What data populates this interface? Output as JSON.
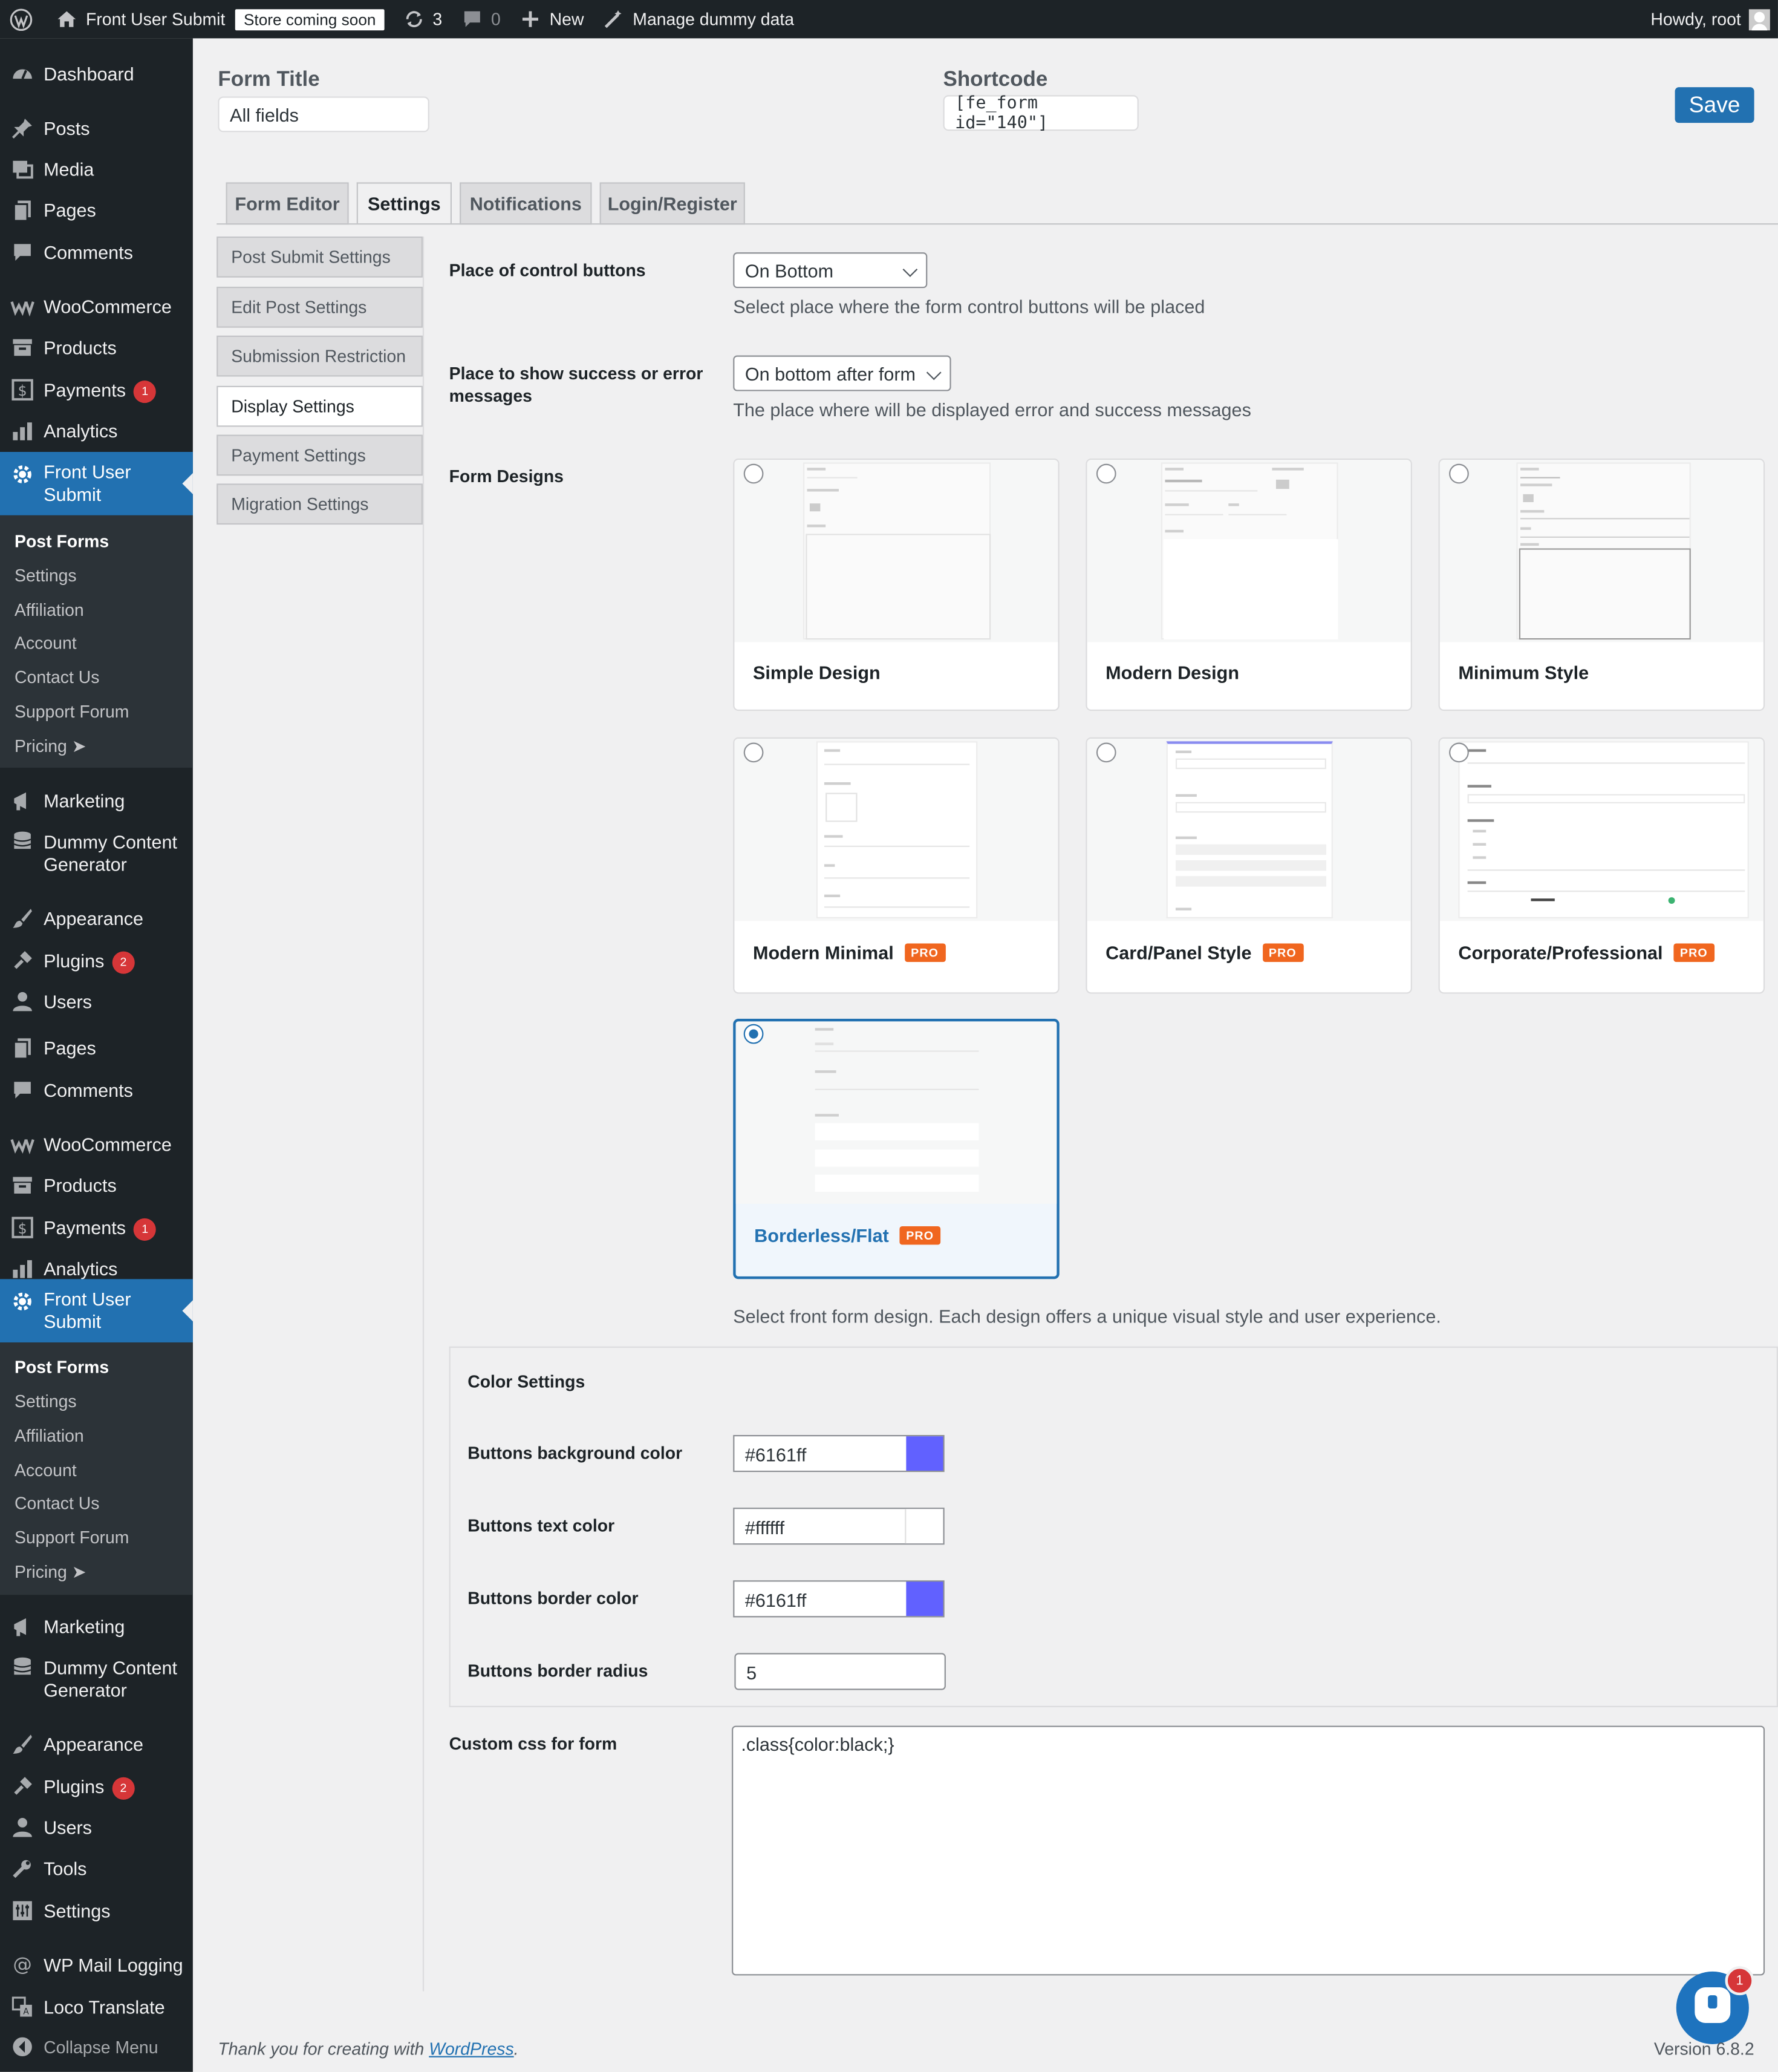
{
  "admin_bar": {
    "site_name": "Front User Submit",
    "coming_soon": "Store coming soon",
    "updates_count": "3",
    "comments_count": "0",
    "new_label": "New",
    "dummy_label": "Manage dummy data",
    "howdy": "Howdy, root"
  },
  "sidebar": {
    "items": [
      {
        "name": "Dashboard",
        "icon": "dashboard-icon"
      },
      {
        "name": "Posts",
        "icon": "pin-icon"
      },
      {
        "name": "Media",
        "icon": "media-icon"
      },
      {
        "name": "Pages",
        "icon": "page-icon"
      },
      {
        "name": "Comments",
        "icon": "comment-icon"
      },
      {
        "name": "WooCommerce",
        "icon": "woo-icon"
      },
      {
        "name": "Products",
        "icon": "archive-icon"
      },
      {
        "name": "Payments",
        "icon": "payments-icon",
        "badge": "1"
      },
      {
        "name": "Analytics",
        "icon": "chart-icon"
      },
      {
        "name": "Front User Submit",
        "icon": "gear-icon"
      },
      {
        "name": "Marketing",
        "icon": "megaphone-icon"
      },
      {
        "name": "Dummy Content Generator",
        "icon": "database-icon"
      },
      {
        "name": "Appearance",
        "icon": "brush-icon"
      },
      {
        "name": "Plugins",
        "icon": "plug-icon",
        "badge": "2"
      },
      {
        "name": "Users",
        "icon": "users-icon"
      },
      {
        "name": "Tools",
        "icon": "wrench-icon"
      },
      {
        "name": "Settings",
        "icon": "settings-icon"
      },
      {
        "name": "WP Mail Logging",
        "icon": "at-icon"
      },
      {
        "name": "Loco Translate",
        "icon": "translate-icon"
      },
      {
        "name": "Collapse Menu",
        "icon": "collapse-icon"
      }
    ],
    "submenu": [
      "Post Forms",
      "Settings",
      "Affiliation",
      "Account",
      "Contact Us",
      "Support Forum",
      "Pricing"
    ]
  },
  "form": {
    "title_label": "Form Title",
    "title_value": "All fields",
    "shortcode_label": "Shortcode",
    "shortcode_value": "[fe_form id=\"140\"]",
    "save_label": "Save"
  },
  "tabs": [
    "Form Editor",
    "Settings",
    "Notifications",
    "Login/Register"
  ],
  "settings_tabs": [
    "Post Submit Settings",
    "Edit Post Settings",
    "Submission Restriction",
    "Display Settings",
    "Payment Settings",
    "Migration Settings"
  ],
  "display": {
    "control_label": "Place of control buttons",
    "control_value": "On Bottom",
    "control_desc": "Select place where the form control buttons will be placed",
    "msg_label": "Place to show success or error messages",
    "msg_value": "On bottom after form",
    "msg_desc": "The place where will be displayed error and success messages",
    "designs_label": "Form Designs",
    "designs_desc": "Select front form design. Each design offers a unique visual style and user experience.",
    "designs": [
      {
        "name": "Simple Design",
        "pro": false
      },
      {
        "name": "Modern Design",
        "pro": false
      },
      {
        "name": "Minimum Style",
        "pro": false
      },
      {
        "name": "Modern Minimal",
        "pro": true
      },
      {
        "name": "Card/Panel Style",
        "pro": true
      },
      {
        "name": "Corporate/Professional",
        "pro": true
      },
      {
        "name": "Borderless/Flat",
        "pro": true,
        "selected": true
      }
    ],
    "pro_label": "PRO"
  },
  "colors": {
    "heading": "Color Settings",
    "bg_label": "Buttons background color",
    "bg_value": "#6161ff",
    "text_label": "Buttons text color",
    "text_value": "#ffffff",
    "border_label": "Buttons border color",
    "border_value": "#6161ff",
    "radius_label": "Buttons border radius",
    "radius_value": "5"
  },
  "custom_css": {
    "label": "Custom css for form",
    "value": ".class{color:black;}"
  },
  "footer": {
    "thanks_prefix": "Thank you for creating with ",
    "thanks_link": "WordPress",
    "thanks_suffix": ".",
    "version": "Version 6.8.2"
  },
  "chat": {
    "count": "1"
  },
  "colors_theme": {
    "admin_dark": "#1d2327",
    "accent": "#2271b1",
    "pro": "#f0661f",
    "badge": "#d63638"
  }
}
